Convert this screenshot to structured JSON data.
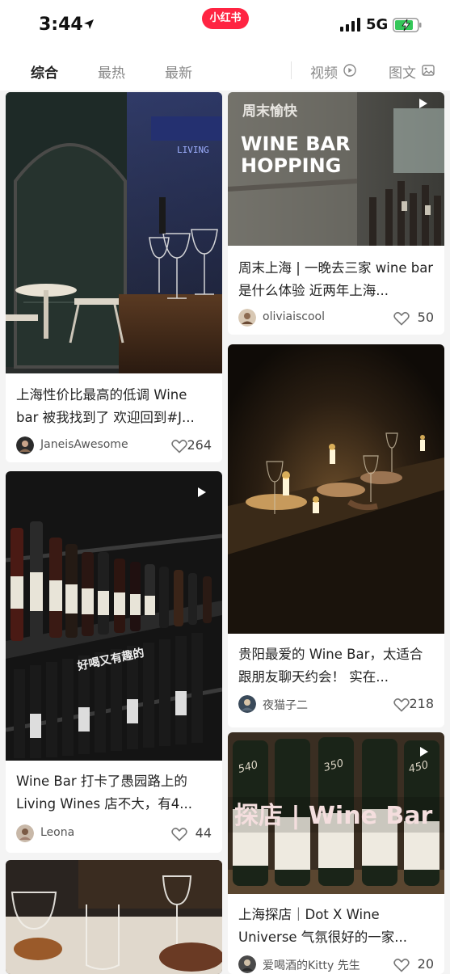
{
  "status": {
    "time": "3:44",
    "app_badge": "小红书",
    "network": "5G"
  },
  "tabs": {
    "items": [
      "综合",
      "最热",
      "最新"
    ],
    "active": "综合",
    "video": "视频",
    "imagetext": "图文"
  },
  "cards": [
    {
      "title": "上海性价比最高的低调 Wine bar 被我找到了 欢迎回到#J...",
      "author": "JaneisAwesome",
      "likes": "264",
      "image_text": "LIVING"
    },
    {
      "title": "周末上海 | 一晚去三家 wine bar是什么体验 近两年上海...",
      "author": "oliviaiscool",
      "likes": "50",
      "image_text_1": "WINE BAR",
      "image_text_2": "HOPPING",
      "image_text_3": "周末愉快"
    },
    {
      "title": "贵阳最爱的 Wine Bar，太适合跟朋友聊天约会！ 实在...",
      "author": "夜猫子二",
      "likes": "218"
    },
    {
      "title": "Wine Bar 打卡了愚园路上的Living Wines 店不大，有4...",
      "author": "Leona",
      "likes": "44",
      "image_text": "好喝又有趣的"
    },
    {
      "title": "上海探店｜Dot X Wine Universe 气氛很好的一家...",
      "author": "爱喝酒的Kitty 先生",
      "likes": "20",
      "image_text": "探店 | Wine Bar",
      "bottle_labels": [
        "540",
        "350",
        "450"
      ]
    }
  ]
}
